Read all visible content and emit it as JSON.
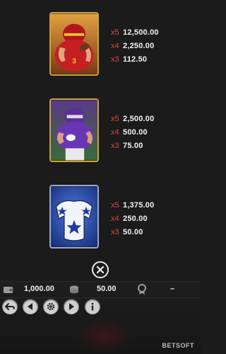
{
  "paytable": [
    {
      "symbol": "red-football-player",
      "pays": [
        {
          "mult": "x5",
          "amount": "12,500.00"
        },
        {
          "mult": "x4",
          "amount": "2,250.00"
        },
        {
          "mult": "x3",
          "amount": "112.50"
        }
      ]
    },
    {
      "symbol": "purple-football-player",
      "pays": [
        {
          "mult": "x5",
          "amount": "2,500.00"
        },
        {
          "mult": "x4",
          "amount": "500.00"
        },
        {
          "mult": "x3",
          "amount": "75.00"
        }
      ]
    },
    {
      "symbol": "blue-shoulder-pads",
      "pays": [
        {
          "mult": "x5",
          "amount": "1,375.00"
        },
        {
          "mult": "x4",
          "amount": "250.00"
        },
        {
          "mult": "x3",
          "amount": "50.00"
        }
      ]
    }
  ],
  "bar": {
    "balance": "1,000.00",
    "bet": "50.00",
    "win": "–"
  },
  "brand": "BETSOFT",
  "colors": {
    "gold_frame": "#c9a23a",
    "multiplier": "#d64a3c",
    "button": "#d0d0d0"
  }
}
